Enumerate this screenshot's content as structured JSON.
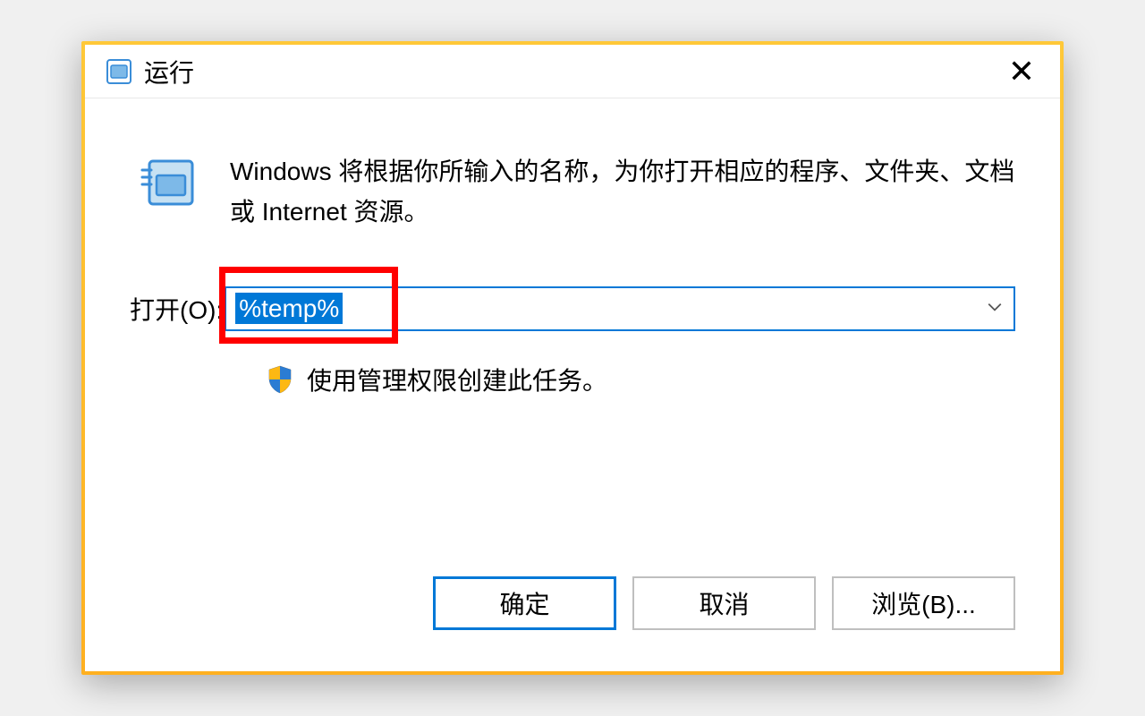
{
  "window": {
    "title": "运行"
  },
  "description": "Windows 将根据你所输入的名称，为你打开相应的程序、文件夹、文档或 Internet 资源。",
  "input": {
    "label": "打开(O):",
    "value": "%temp%"
  },
  "admin_task": "使用管理权限创建此任务。",
  "buttons": {
    "ok": "确定",
    "cancel": "取消",
    "browse": "浏览(B)..."
  }
}
